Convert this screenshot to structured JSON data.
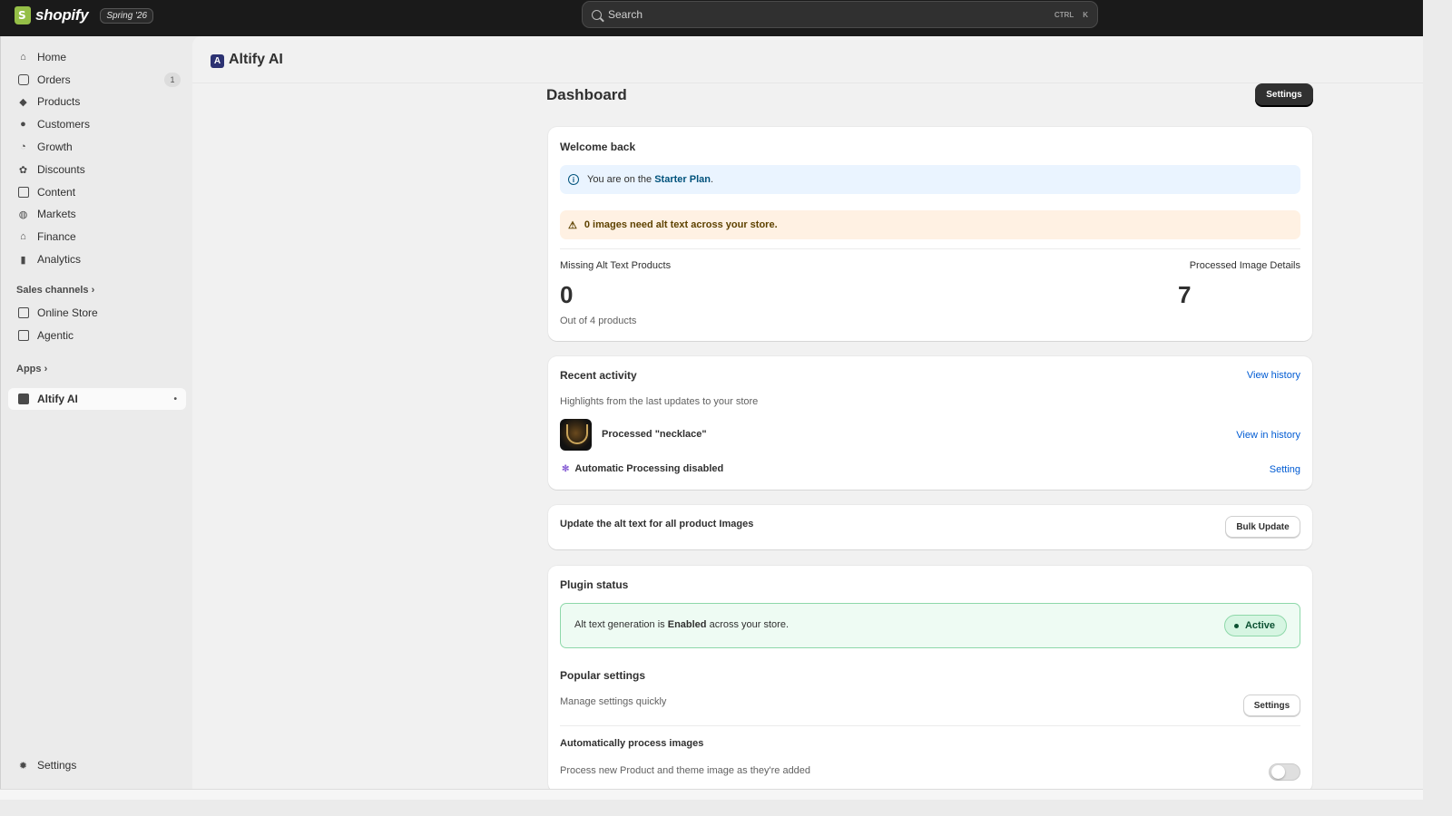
{
  "topbar": {
    "brand": "shopify",
    "edition": "Spring '26",
    "search_placeholder": "Search",
    "shortcut_ctrl": "CTRL",
    "shortcut_key": "K"
  },
  "sidebar": {
    "items": [
      {
        "label": "Home",
        "icon": "home-icon"
      },
      {
        "label": "Orders",
        "icon": "inbox-icon",
        "badge": "1"
      },
      {
        "label": "Products",
        "icon": "tag-icon"
      },
      {
        "label": "Customers",
        "icon": "person-icon"
      },
      {
        "label": "Growth",
        "icon": "gauge-icon"
      },
      {
        "label": "Discounts",
        "icon": "discount-icon"
      },
      {
        "label": "Content",
        "icon": "content-icon"
      },
      {
        "label": "Markets",
        "icon": "globe-icon"
      },
      {
        "label": "Finance",
        "icon": "bank-icon"
      },
      {
        "label": "Analytics",
        "icon": "bar-chart-icon"
      }
    ],
    "sales_channels_label": "Sales channels",
    "channels": [
      {
        "label": "Online Store",
        "icon": "store-icon"
      },
      {
        "label": "Agentic",
        "icon": "agentic-icon"
      }
    ],
    "apps_label": "Apps",
    "active_app": "Altify AI",
    "settings_label": "Settings"
  },
  "app": {
    "title": "Altify AI",
    "logo_letter": "A"
  },
  "page": {
    "title": "Dashboard",
    "settings_button": "Settings"
  },
  "welcome": {
    "title": "Welcome back",
    "plan_prefix": "You are on the ",
    "plan_name": "Starter Plan",
    "plan_suffix": ".",
    "warning": "0 images need alt text across your store.",
    "missing_label": "Missing Alt Text Products",
    "missing_value": "0",
    "missing_sub": "Out of 4 products",
    "processed_label": "Processed Image Details",
    "processed_value": "7"
  },
  "activity": {
    "title": "Recent activity",
    "view_history": "View history",
    "subtitle": "Highlights from the last updates to your store",
    "item_text": "Processed \"necklace\"",
    "item_link": "View in history",
    "auto_text": "Automatic Processing disabled",
    "auto_link": "Setting"
  },
  "bulk": {
    "text": "Update the alt text for all product Images",
    "button": "Bulk Update"
  },
  "plugin": {
    "title": "Plugin status",
    "status_prefix": "Alt text generation is ",
    "status_bold": "Enabled",
    "status_suffix": " across your store.",
    "badge": "Active",
    "popular_title": "Popular settings",
    "popular_sub": "Manage settings quickly",
    "popular_button": "Settings",
    "auto_title": "Automatically process images",
    "auto_sub": "Process new Product and theme image as they're added",
    "auto_enabled": false
  },
  "colors": {
    "topbar": "#1a1a1a",
    "link": "#005bd3",
    "success": "#0c5132",
    "info_bg": "#eaf4ff",
    "warn_bg": "#fff1e3"
  }
}
